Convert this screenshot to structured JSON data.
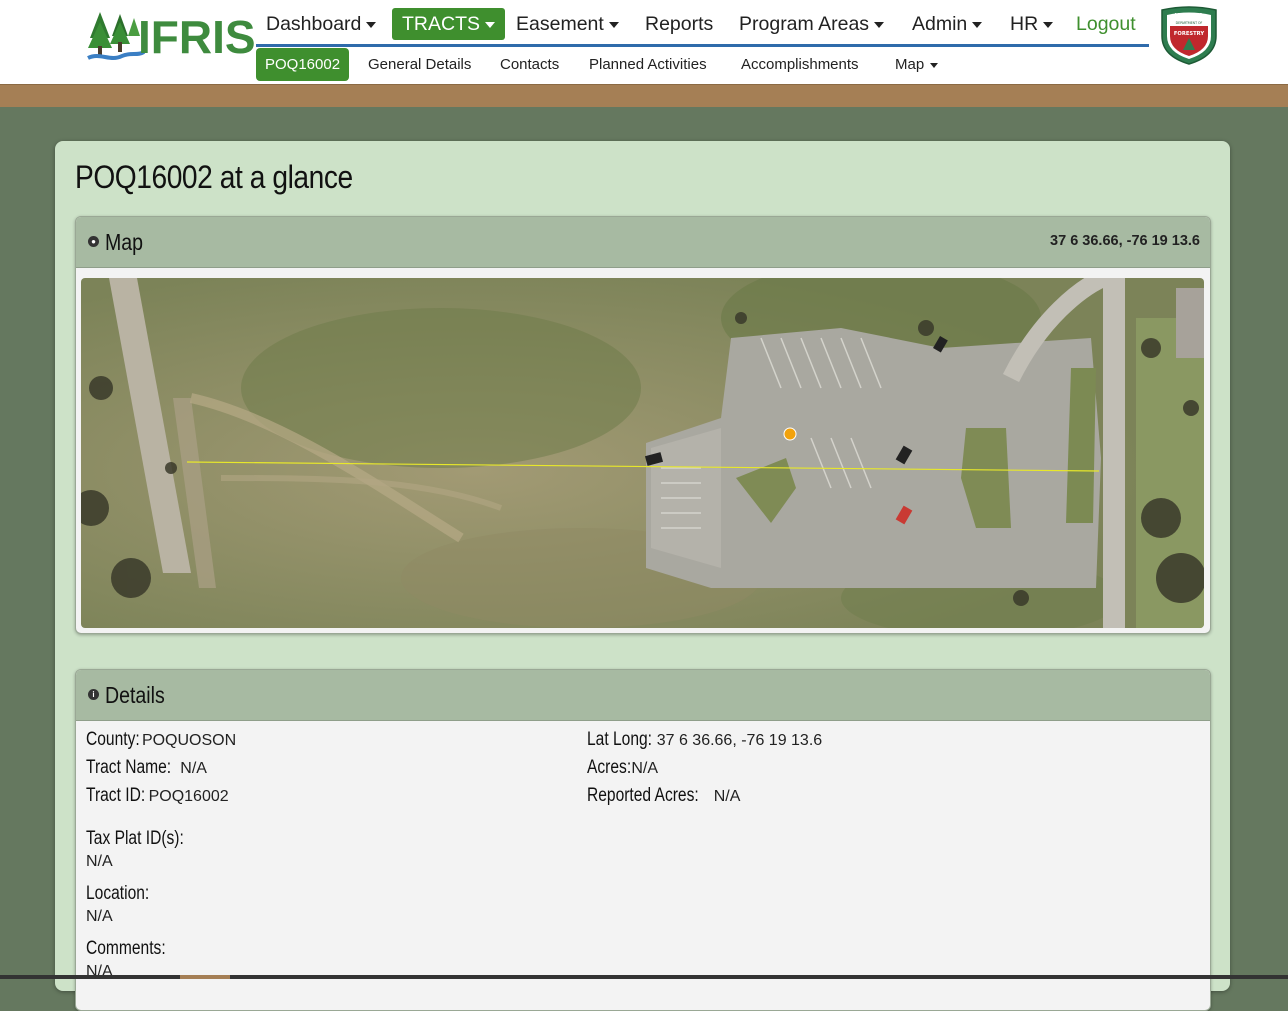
{
  "header": {
    "logo_text": "IFRIS",
    "nav": [
      {
        "label": "Dashboard",
        "dropdown": true
      },
      {
        "label": "TRACTS",
        "dropdown": true,
        "active": true
      },
      {
        "label": "Easement",
        "dropdown": true
      },
      {
        "label": "Reports",
        "dropdown": false
      },
      {
        "label": "Program Areas",
        "dropdown": true
      },
      {
        "label": "Admin",
        "dropdown": true
      },
      {
        "label": "HR",
        "dropdown": true
      },
      {
        "label": "Logout",
        "dropdown": false
      }
    ],
    "subnav": [
      {
        "label": "POQ16002",
        "active": true
      },
      {
        "label": "General Details"
      },
      {
        "label": "Contacts"
      },
      {
        "label": "Planned Activities"
      },
      {
        "label": "Accomplishments"
      },
      {
        "label": "Map",
        "dropdown": true
      }
    ],
    "seal": {
      "top_text": "VIRGINIA",
      "middle_text": "DEPARTMENT OF",
      "bottom_text": "FORESTRY"
    }
  },
  "page": {
    "title": "POQ16002 at a glance"
  },
  "map_panel": {
    "title": "Map",
    "icon": "globe-icon",
    "coords": "37 6 36.66, -76 19 13.6"
  },
  "details_panel": {
    "title": "Details",
    "icon": "info-icon",
    "left": [
      {
        "label": "County:",
        "value": "POQUOSON"
      },
      {
        "label": "Tract Name:",
        "value": "N/A"
      },
      {
        "label": "Tract ID:",
        "value": "POQ16002"
      }
    ],
    "right": [
      {
        "label": "Lat Long:",
        "value": "37 6 36.66, -76 19 13.6"
      },
      {
        "label": "Acres:",
        "value": "N/A"
      },
      {
        "label": "Reported Acres:",
        "value": "N/A"
      }
    ],
    "blocks": [
      {
        "label": "Tax Plat ID(s):",
        "value": "N/A"
      },
      {
        "label": "Location:",
        "value": "N/A"
      },
      {
        "label": "Comments:",
        "value": "N/A"
      }
    ]
  },
  "colors": {
    "brand_green": "#3f8f2e",
    "nav_underline": "#2f6bab",
    "page_bg": "#65785f",
    "card_bg": "#cde2c8",
    "panel_header": "#a7baa2",
    "brown_bar": "#a57f55"
  }
}
